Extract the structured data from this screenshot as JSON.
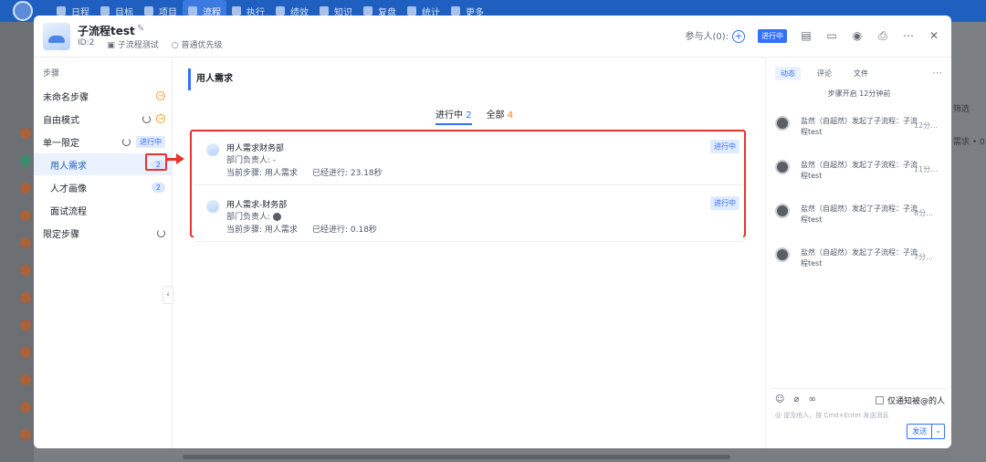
{
  "nav": {
    "items": [
      "日程",
      "目标",
      "项目",
      "流程",
      "执行",
      "绩效",
      "知识",
      "复盘",
      "统计",
      "更多"
    ],
    "active_index": 3
  },
  "background": {
    "right_texts": [
      "筛选",
      "需求 • 0"
    ]
  },
  "header": {
    "title": "子流程test",
    "id": "ID:2",
    "category": "子流程测试",
    "priority": "普通优先级",
    "participants": "参与人(0):",
    "status": "进行中"
  },
  "steps": {
    "heading": "步骤",
    "items": [
      {
        "label": "未命名步骤",
        "indent": false
      },
      {
        "label": "自由模式",
        "indent": false
      },
      {
        "label": "单一限定",
        "indent": false,
        "tag": "进行中"
      },
      {
        "label": "用人需求",
        "indent": true,
        "count": "2",
        "selected": true
      },
      {
        "label": "人才画像",
        "indent": true,
        "count": "2"
      },
      {
        "label": "面试流程",
        "indent": true
      },
      {
        "label": "限定步骤",
        "indent": false
      }
    ]
  },
  "main": {
    "section_title": "用人需求",
    "tabs": [
      {
        "label": "进行中",
        "count": "2"
      },
      {
        "label": "全部",
        "count": "4"
      }
    ],
    "cards": [
      {
        "name": "用人需求财务部",
        "owner": "部门负责人: -",
        "current_step": "当前步骤: 用人需求",
        "elapsed": "已经进行: 23.18秒",
        "status": "进行中"
      },
      {
        "name": "用人需求-财务部",
        "owner": "部门负责人:",
        "current_step": "当前步骤: 用人需求",
        "elapsed": "已经进行: 0.18秒",
        "status": "进行中"
      }
    ]
  },
  "activity": {
    "tabs": [
      "动态",
      "评论",
      "文件"
    ],
    "started": "步骤开启 12分钟前",
    "items": [
      {
        "text": "盐然（自超然）发起了子流程：子流程test",
        "time": "12分..."
      },
      {
        "text": "盐然（自超然）发起了子流程：子流程test",
        "time": "11分..."
      },
      {
        "text": "盐然（自超然）发起了子流程：子流程test",
        "time": "8分..."
      },
      {
        "text": "盐然（自超然）发起了子流程：子流程test",
        "time": "7分..."
      }
    ],
    "notify_label": "仅通知被@的人",
    "placeholder": "@ 提及他人，按 Cmd+Enter 发送消息",
    "send": "发送"
  }
}
